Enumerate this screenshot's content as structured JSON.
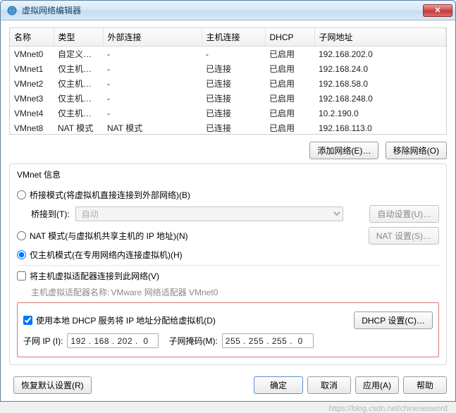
{
  "titlebar": {
    "title": "虚拟网络编辑器"
  },
  "table": {
    "headers": {
      "name": "名称",
      "type": "类型",
      "external": "外部连接",
      "host": "主机连接",
      "dhcp": "DHCP",
      "subnet": "子网地址"
    },
    "rows": [
      {
        "name": "VMnet0",
        "type": "自定义…",
        "external": "-",
        "host": "-",
        "dhcp": "已启用",
        "subnet": "192.168.202.0"
      },
      {
        "name": "VMnet1",
        "type": "仅主机…",
        "external": "-",
        "host": "已连接",
        "dhcp": "已启用",
        "subnet": "192.168.24.0"
      },
      {
        "name": "VMnet2",
        "type": "仅主机…",
        "external": "-",
        "host": "已连接",
        "dhcp": "已启用",
        "subnet": "192.168.58.0"
      },
      {
        "name": "VMnet3",
        "type": "仅主机…",
        "external": "-",
        "host": "已连接",
        "dhcp": "已启用",
        "subnet": "192.168.248.0"
      },
      {
        "name": "VMnet4",
        "type": "仅主机…",
        "external": "-",
        "host": "已连接",
        "dhcp": "已启用",
        "subnet": "10.2.190.0"
      },
      {
        "name": "VMnet8",
        "type": "NAT 模式",
        "external": "NAT 模式",
        "host": "已连接",
        "dhcp": "已启用",
        "subnet": "192.168.113.0"
      }
    ]
  },
  "buttons": {
    "add_network": "添加网络(E)…",
    "remove_network": "移除网络(O)",
    "auto_settings": "自动设置(U)…",
    "nat_settings": "NAT 设置(S)…",
    "dhcp_settings": "DHCP 设置(C)…",
    "restore_defaults": "恢复默认设置(R)",
    "ok": "确定",
    "cancel": "取消",
    "apply": "应用(A)",
    "help": "帮助"
  },
  "fieldset": {
    "legend": "VMnet 信息",
    "bridged_label": "桥接模式(将虚拟机直接连接到外部网络)(B)",
    "bridged_to_label": "桥接到(T):",
    "bridged_to_value": "自动",
    "nat_label": "NAT 模式(与虚拟机共享主机的 IP 地址)(N)",
    "hostonly_label": "仅主机模式(在专用网络内连接虚拟机)(H)",
    "host_adapter_check": "将主机虚拟适配器连接到此网络(V)",
    "host_adapter_name_label": "主机虚拟适配器名称:",
    "host_adapter_name_value": "VMware 网络适配器 VMnet0",
    "use_dhcp_check": "使用本地 DHCP 服务将 IP 地址分配给虚拟机(D)",
    "subnet_ip_label": "子网 IP (I):",
    "subnet_ip_value": "192 . 168 . 202 .  0",
    "subnet_mask_label": "子网掩码(M):",
    "subnet_mask_value": "255 . 255 . 255 .  0"
  },
  "watermark": "https://blog.csdn.net/chinesesword"
}
